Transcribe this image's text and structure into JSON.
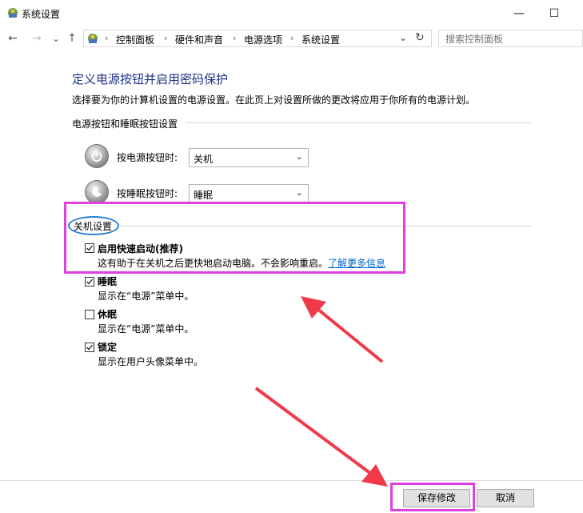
{
  "window": {
    "title": "系统设置",
    "minimize": "—",
    "maximize": "☐"
  },
  "nav": {
    "back": "←",
    "forward": "→",
    "dropdown": "⌄",
    "up": "↑",
    "refresh": "↻",
    "addr_dropdown": "⌄"
  },
  "breadcrumb": [
    "控制面板",
    "硬件和声音",
    "电源选项",
    "系统设置"
  ],
  "breadcrumb_sep": "›",
  "search": {
    "placeholder": "搜索控制面板"
  },
  "page": {
    "heading": "定义电源按钮并启用密码保护",
    "subtitle": "选择要为你的计算机设置的电源设置。在此页上对设置所做的更改将应用于你所有的电源计划。"
  },
  "power_group": {
    "title": "电源按钮和睡眠按钮设置",
    "rows": [
      {
        "label": "按电源按钮时:",
        "value": "关机",
        "icon": "power-icon"
      },
      {
        "label": "按睡眠按钮时:",
        "value": "睡眠",
        "icon": "sleep-icon"
      }
    ]
  },
  "shutdown_group": {
    "title": "关机设置",
    "items": [
      {
        "label": "启用快速启动(推荐)",
        "desc": "这有助于在关机之后更快地启动电脑。不会影响重启。",
        "link": "了解更多信息",
        "checked": true
      },
      {
        "label": "睡眠",
        "desc": "显示在“电源”菜单中。",
        "checked": true
      },
      {
        "label": "休眠",
        "desc": "显示在“电源”菜单中。",
        "checked": false
      },
      {
        "label": "锁定",
        "desc": "显示在用户头像菜单中。",
        "checked": true
      }
    ]
  },
  "buttons": {
    "save": "保存修改",
    "cancel": "取消"
  },
  "colors": {
    "heading": "#1e3287",
    "annotation_box": "#e040e0",
    "annotation_ellipse": "#2a7fd4",
    "arrow": "#f03a4a",
    "link": "#0066cc"
  }
}
